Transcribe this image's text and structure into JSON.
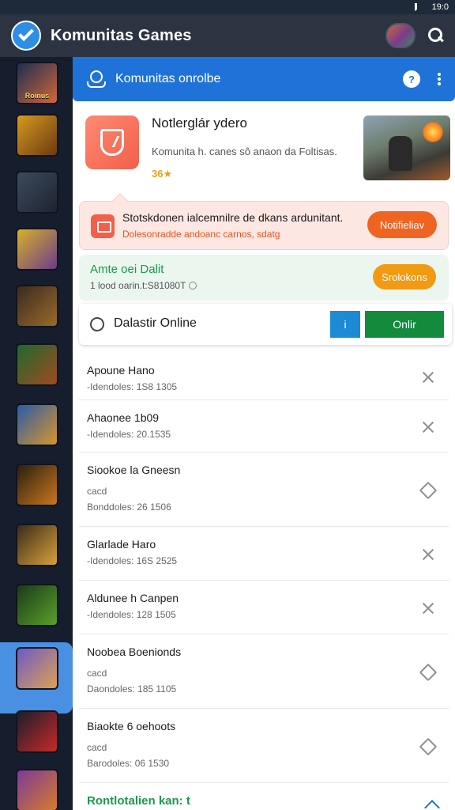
{
  "status_bar": {
    "right_text": "19:0"
  },
  "app_bar": {
    "title": "Komunitas Games"
  },
  "sidebar": {
    "games": [
      {
        "label": "Roinus",
        "colors": [
          "#1b2d52",
          "#d0683a"
        ]
      },
      {
        "label": "",
        "colors": [
          "#d69a1e",
          "#6b3a12"
        ]
      },
      {
        "label": "",
        "colors": [
          "#3c4a5e",
          "#1e2430"
        ]
      },
      {
        "label": "",
        "colors": [
          "#d8b02a",
          "#6a3c8a"
        ]
      },
      {
        "label": "",
        "colors": [
          "#3a2a22",
          "#9a6a2a"
        ]
      },
      {
        "label": "",
        "colors": [
          "#1e6a2e",
          "#a04a20"
        ]
      },
      {
        "label": "",
        "colors": [
          "#2a5aa8",
          "#d8962a"
        ]
      },
      {
        "label": "",
        "colors": [
          "#2a1e10",
          "#c8781e"
        ]
      },
      {
        "label": "",
        "colors": [
          "#3a2a1a",
          "#d8a23a"
        ]
      },
      {
        "label": "",
        "colors": [
          "#1a3a1a",
          "#5aa02a"
        ]
      },
      {
        "label": "",
        "colors": [
          "#6a5ac8",
          "#e0a050"
        ]
      },
      {
        "label": "",
        "colors": [
          "#1a1e2a",
          "#c82a2a"
        ]
      },
      {
        "label": "",
        "colors": [
          "#7a3a9a",
          "#d87a2a"
        ]
      }
    ]
  },
  "header": {
    "title": "Komunitas onrolbe"
  },
  "feature": {
    "title": "Notlerglár ydero",
    "subtitle": "Komunita h. canes sô anaon da Foltisas.",
    "rating": "36★"
  },
  "notice": {
    "title": "Stotskdonen ialcemnilre de dkans ardunitant.",
    "subtitle": "Dolesonradde andoanc carnos, sdatg",
    "button": "Notifieliav"
  },
  "online_card": {
    "title": "Amte oei Dalit",
    "subtitle": "1 lood oarin.t:S81080T",
    "button": "Srolokons"
  },
  "status_row": {
    "label": "Dalastir Online",
    "info_button": "i",
    "online_button": "Onlir"
  },
  "list": [
    {
      "name": "Apoune Hano",
      "meta1": "",
      "meta2": "-Idendoles: 1S8 1305",
      "icon": "close"
    },
    {
      "name": "Ahaonee 1b09",
      "meta1": "",
      "meta2": "-Idendoles: 20.1535",
      "icon": "close"
    },
    {
      "name": "Siookoe la Gneesn",
      "meta1": "cacd",
      "meta2": "Bonddoles: 26 1506",
      "icon": "diamond"
    },
    {
      "name": "Glarlade Haro",
      "meta1": "",
      "meta2": "-Idendoles: 16S 2525",
      "icon": "close"
    },
    {
      "name": "Aldunee h Canpen",
      "meta1": "",
      "meta2": "-Idendoles: 128 1505",
      "icon": "close"
    },
    {
      "name": "Noobea Boenionds",
      "meta1": "cacd",
      "meta2": "Daondoles: 185 1105",
      "icon": "diamond"
    },
    {
      "name": "Biaokte 6 oehoots",
      "meta1": "cacd",
      "meta2": "Barodoles: 06 1530",
      "icon": "diamond"
    }
  ],
  "bottom_section": {
    "title": "Rontlotalien kan: t"
  }
}
